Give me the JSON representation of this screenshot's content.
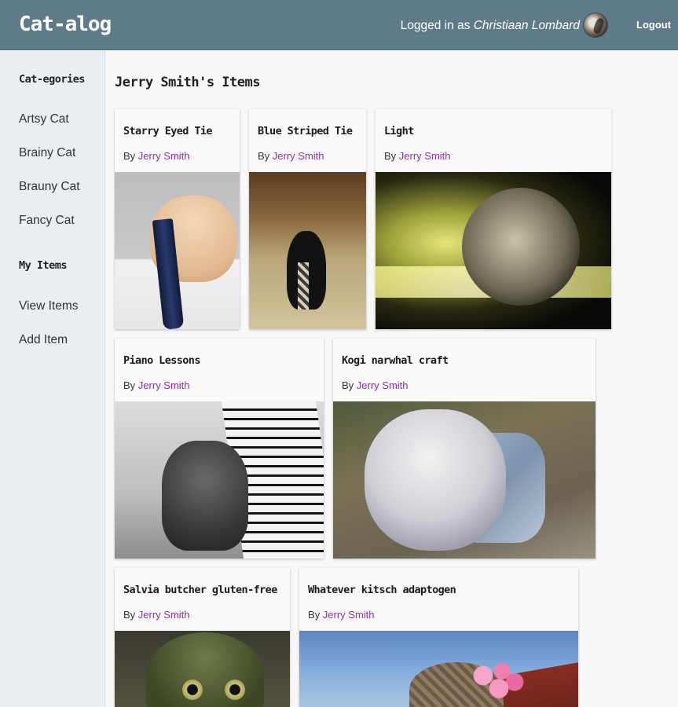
{
  "header": {
    "brand": "Cat-alog",
    "logged_in_prefix": "Logged in as",
    "user_name": "Christiaan Lombard",
    "logout_label": "Logout",
    "bg_color": "#5f7a89"
  },
  "sidebar": {
    "categories_heading": "Cat-egories",
    "categories": [
      {
        "label": "Artsy Cat"
      },
      {
        "label": "Brainy Cat"
      },
      {
        "label": "Brauny Cat"
      },
      {
        "label": "Fancy Cat"
      }
    ],
    "my_items_heading": "My Items",
    "my_items": [
      {
        "label": "View Items"
      },
      {
        "label": "Add Item"
      }
    ]
  },
  "main": {
    "title": "Jerry Smith's Items",
    "by_prefix": "By",
    "author_color": "#8e2ea8",
    "items": [
      {
        "title": "Starry Eyed Tie",
        "author": "Jerry Smith",
        "image": "cat-with-tie-photo"
      },
      {
        "title": "Blue Striped Tie",
        "author": "Jerry Smith",
        "image": "black-cat-with-tie-photo"
      },
      {
        "title": "Light",
        "author": "Jerry Smith",
        "image": "kitten-in-light-photo"
      },
      {
        "title": "Piano Lessons",
        "author": "Jerry Smith",
        "image": "cat-at-piano-photo"
      },
      {
        "title": "Kogi narwhal craft",
        "author": "Jerry Smith",
        "image": "kitten-in-denim-vest-photo"
      },
      {
        "title": "Salvia butcher gluten-free",
        "author": "Jerry Smith",
        "image": "cat-in-helmet-photo"
      },
      {
        "title": "Whatever kitsch adaptogen",
        "author": "Jerry Smith",
        "image": "cat-in-flower-hat-photo"
      }
    ]
  }
}
